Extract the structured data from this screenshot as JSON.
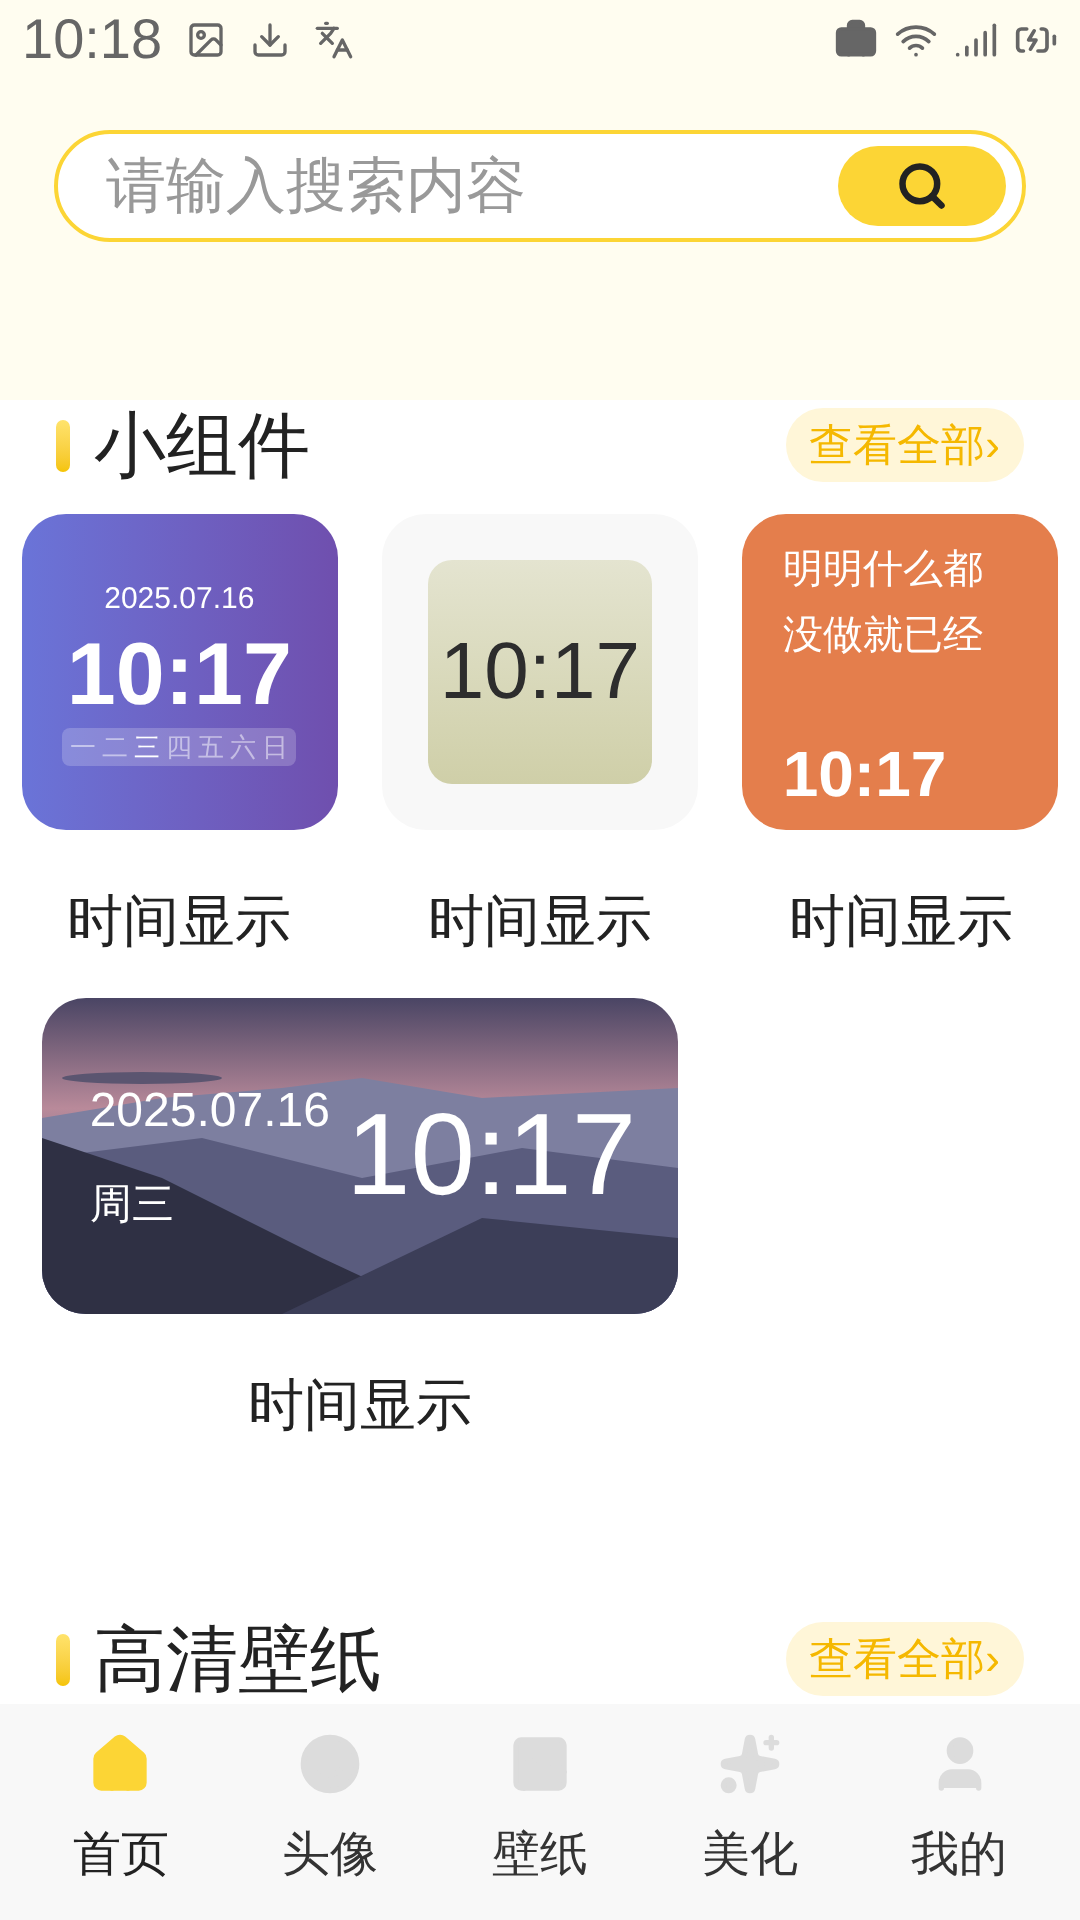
{
  "status_bar": {
    "time": "10:18"
  },
  "search": {
    "placeholder": "请输入搜索内容"
  },
  "sections": [
    {
      "title": "小组件",
      "more": "查看全部›",
      "widgets": [
        {
          "kind": "calendar",
          "date": "2025.07.16",
          "time": "10:17",
          "weekdays": [
            {
              "label": "一",
              "selected": false
            },
            {
              "label": "二",
              "selected": false
            },
            {
              "label": "三",
              "selected": true
            },
            {
              "label": "四",
              "selected": false
            },
            {
              "label": "五",
              "selected": false
            },
            {
              "label": "六",
              "selected": false
            },
            {
              "label": "日",
              "selected": false
            }
          ],
          "label": "时间显示"
        },
        {
          "kind": "flip",
          "time": "10:17",
          "label": "时间显示"
        },
        {
          "kind": "text",
          "message": "明明什么都没做就已经",
          "time": "10:17",
          "label": "时间显示"
        },
        {
          "date": "2025.07.16",
          "weekday": "周三",
          "time": "10:17",
          "label": "时间显示"
        }
      ]
    },
    {
      "title": "高清壁纸",
      "more": "查看全部›"
    }
  ],
  "nav": [
    {
      "label": "首页",
      "selected": true
    },
    {
      "label": "头像",
      "selected": false
    },
    {
      "label": "壁纸",
      "selected": false
    },
    {
      "label": "美化",
      "selected": false
    },
    {
      "label": "我的",
      "selected": false
    }
  ]
}
